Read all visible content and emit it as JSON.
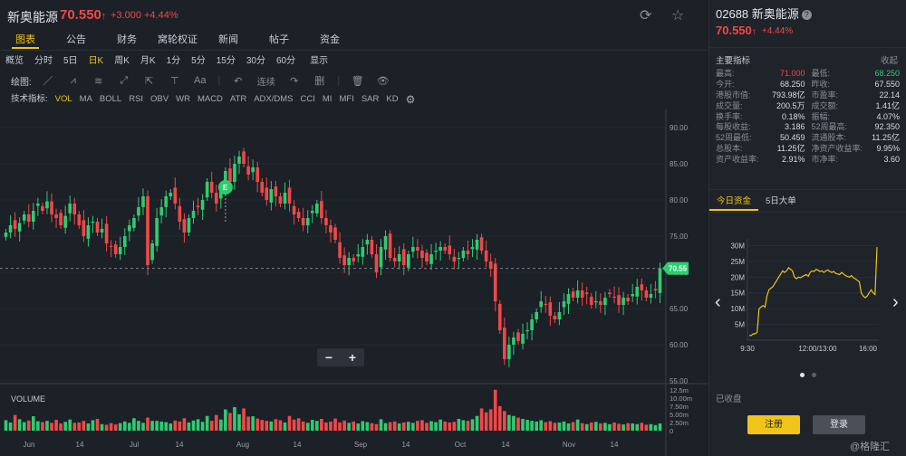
{
  "header": {
    "name": "新奥能源",
    "price": "70.550",
    "arrow": "↑",
    "change": "+3.000 +4.44%",
    "refresh_icon": "refresh-icon",
    "star_icon": "star-icon"
  },
  "tabs": [
    "图表",
    "公告",
    "财务",
    "窝轮权证",
    "新闻",
    "帖子",
    "资金"
  ],
  "active_tab": 0,
  "periods": [
    "概览",
    "分时",
    "5日",
    "日K",
    "周K",
    "月K",
    "1分",
    "5分",
    "15分",
    "30分",
    "60分",
    "显示"
  ],
  "active_period": 3,
  "draw": {
    "label": "绘图:",
    "tools": [
      "／",
      "⩘",
      "≋",
      "⤢",
      "⇱",
      "⊤",
      "Aa",
      "|",
      "↶",
      "连续",
      "↷",
      "删",
      "|",
      "🗑",
      "👁"
    ]
  },
  "indicators": {
    "label": "技术指标:",
    "items": [
      "VOL",
      "MA",
      "BOLL",
      "RSI",
      "OBV",
      "WR",
      "MACD",
      "ATR",
      "ADX/DMS",
      "CCI",
      "MI",
      "MFI",
      "SAR",
      "KD"
    ],
    "active": 0
  },
  "zoom": {
    "minus": "−",
    "plus": "+"
  },
  "chart_data": {
    "type": "candlestick",
    "price_axis": [
      "90.00",
      "85.00",
      "80.00",
      "75.00",
      "70.00",
      "65.00",
      "60.00",
      "55.00"
    ],
    "ylim": [
      55,
      92.5
    ],
    "last_price": 70.55,
    "last_price_label": "70.55",
    "x_ticks": [
      "Jun",
      "14",
      "Jul",
      "14",
      "Aug",
      "14",
      "Sep",
      "14",
      "Oct",
      "14",
      "Nov",
      "14"
    ],
    "volume_label": "VOLUME",
    "volume_axis": [
      "12.5m",
      "10.00m",
      "7.50m",
      "5.00m",
      "2.50m",
      "0"
    ],
    "volume_ylim": [
      0,
      13
    ],
    "event_marker": "E",
    "closes": [
      75.5,
      76.5,
      76.0,
      76.8,
      78.0,
      77.0,
      78.5,
      79.5,
      78.5,
      79.8,
      78.0,
      77.5,
      76.5,
      77.8,
      79.5,
      78.0,
      76.5,
      75.0,
      76.5,
      77.0,
      75.5,
      76.0,
      74.0,
      73.5,
      72.5,
      73.5,
      75.0,
      76.5,
      77.5,
      79.0,
      80.5,
      71.0,
      74.0,
      77.5,
      79.0,
      80.5,
      81.0,
      79.5,
      77.0,
      75.5,
      77.5,
      78.5,
      79.0,
      80.0,
      82.5,
      81.0,
      79.5,
      81.5,
      84.0,
      82.5,
      85.0,
      86.0,
      85.0,
      83.5,
      84.5,
      82.5,
      81.0,
      80.0,
      81.5,
      80.5,
      79.5,
      81.0,
      79.5,
      78.0,
      77.5,
      76.5,
      77.5,
      78.5,
      79.5,
      77.5,
      76.5,
      75.5,
      74.5,
      72.0,
      71.0,
      72.0,
      71.5,
      72.5,
      73.5,
      74.5,
      72.5,
      70.0,
      73.5,
      75.0,
      72.0,
      71.5,
      72.5,
      71.0,
      72.5,
      73.5,
      73.0,
      72.0,
      71.5,
      72.5,
      73.0,
      73.5,
      73.0,
      72.5,
      71.5,
      72.0,
      73.0,
      72.5,
      73.5,
      74.5,
      73.0,
      71.5,
      70.5,
      66.0,
      62.0,
      58.0,
      60.0,
      61.0,
      60.5,
      61.5,
      62.0,
      63.5,
      64.5,
      66.0,
      65.5,
      64.0,
      63.5,
      64.5,
      66.0,
      67.0,
      66.5,
      67.5,
      66.5,
      67.0,
      65.5,
      66.0,
      65.5,
      66.5,
      67.0,
      66.5,
      65.5,
      66.5,
      66.0,
      67.0,
      68.0,
      67.5,
      66.5,
      67.0,
      67.5,
      70.55
    ],
    "volumes": [
      3.2,
      2.5,
      4.8,
      3.5,
      2.6,
      3.1,
      4.4,
      2.9,
      2.6,
      3.0,
      2.4,
      3.3,
      2.2,
      2.7,
      3.4,
      2.4,
      2.5,
      3.0,
      2.2,
      3.2,
      3.6,
      2.0,
      1.8,
      2.3,
      1.9,
      2.3,
      2.8,
      2.4,
      3.8,
      3.0,
      2.4,
      4.0,
      3.0,
      3.0,
      2.8,
      2.6,
      2.2,
      3.1,
      2.8,
      3.8,
      2.5,
      3.1,
      3.5,
      2.7,
      4.5,
      3.0,
      4.8,
      3.4,
      6.5,
      5.4,
      7.2,
      5.0,
      6.8,
      4.3,
      4.4,
      3.7,
      3.3,
      3.0,
      2.8,
      3.5,
      3.2,
      2.5,
      4.5,
      3.4,
      3.8,
      2.8,
      2.4,
      3.3,
      3.0,
      3.6,
      2.5,
      2.8,
      3.7,
      2.5,
      3.1,
      2.4,
      2.8,
      2.2,
      2.9,
      2.6,
      2.3,
      2.0,
      3.5,
      2.3,
      2.6,
      2.8,
      2.2,
      2.5,
      2.7,
      2.4,
      3.0,
      3.2,
      2.4,
      2.9,
      2.6,
      3.4,
      2.8,
      2.5,
      2.7,
      3.6,
      3.2,
      3.0,
      3.5,
      4.5,
      6.8,
      5.6,
      6.5,
      12.5,
      7.5,
      6.0,
      4.8,
      4.5,
      4.0,
      3.6,
      3.3,
      3.0,
      2.8,
      3.2,
      2.6,
      2.9,
      2.4,
      2.5,
      2.8,
      2.2,
      2.6,
      3.4,
      2.3,
      2.0,
      2.5,
      2.7,
      2.2,
      2.4,
      2.0,
      2.5,
      2.1,
      1.9,
      2.3,
      2.2,
      2.0,
      2.4,
      1.8,
      2.0,
      1.7,
      2.2
    ]
  },
  "right": {
    "code": "02688",
    "name": "新奥能源",
    "help": "?",
    "price": "70.550",
    "arrow": "↑",
    "change": "+4.44%",
    "section": "主要指标",
    "collapse": "收起",
    "metrics": [
      [
        {
          "k": "最高:",
          "v": "71.000",
          "c": "red"
        },
        {
          "k": "最低:",
          "v": "68.250",
          "c": "green"
        }
      ],
      [
        {
          "k": "今开:",
          "v": "68.250",
          "c": ""
        },
        {
          "k": "昨收:",
          "v": "67.550",
          "c": ""
        }
      ],
      [
        {
          "k": "港股市值:",
          "v": "793.98亿",
          "c": ""
        },
        {
          "k": "市盈率:",
          "v": "22.14",
          "c": ""
        }
      ],
      [
        {
          "k": "成交量:",
          "v": "200.5万",
          "c": ""
        },
        {
          "k": "成交额:",
          "v": "1.41亿",
          "c": ""
        }
      ],
      [
        {
          "k": "换手率:",
          "v": "0.18%",
          "c": ""
        },
        {
          "k": "振幅:",
          "v": "4.07%",
          "c": ""
        }
      ],
      [
        {
          "k": "每股收益:",
          "v": "3.186",
          "c": ""
        },
        {
          "k": "52周最高:",
          "v": "92.350",
          "c": ""
        }
      ],
      [
        {
          "k": "52周最低:",
          "v": "50.459",
          "c": ""
        },
        {
          "k": "流通股本:",
          "v": "11.25亿",
          "c": ""
        }
      ],
      [
        {
          "k": "总股本:",
          "v": "11.25亿",
          "c": ""
        },
        {
          "k": "净资产收益率:",
          "v": "9.95%",
          "c": ""
        }
      ],
      [
        {
          "k": "资产收益率:",
          "v": "2.91%",
          "c": ""
        },
        {
          "k": "市净率:",
          "v": "3.60",
          "c": ""
        }
      ]
    ],
    "tabs": [
      "今日资金",
      "5日大单"
    ],
    "closed": "已收盘",
    "register": "注册",
    "login": "登录"
  },
  "fund_chart": {
    "type": "line",
    "y_axis": [
      "30M",
      "25M",
      "20M",
      "15M",
      "10M",
      "5M"
    ],
    "ylim": [
      0,
      31
    ],
    "x_axis": [
      "9:30",
      "12:00/13:00",
      "16:00"
    ],
    "values": [
      1.5,
      1.5,
      2,
      2,
      2.5,
      10,
      10.5,
      11,
      10.5,
      14,
      16,
      16.5,
      17,
      18,
      19,
      20,
      21,
      22,
      21.5,
      22,
      23,
      22.5,
      22,
      20,
      19.5,
      20,
      19.8,
      20.2,
      20.5,
      20.8,
      20.3,
      21.5,
      22,
      21.8,
      22.5,
      22.2,
      21.8,
      22,
      21.5,
      22,
      22.3,
      21.8,
      21.5,
      21.8,
      21.2,
      21,
      20.8,
      21.5,
      21,
      20.5,
      20.2,
      20,
      20.5,
      19.8,
      19.5,
      19,
      18.5,
      15,
      14,
      13.5,
      14,
      15,
      16,
      15,
      14.5,
      29.5
    ],
    "line_color": "#f0c419",
    "prev_arrow": "‹",
    "next_arrow": "›"
  },
  "watermark": "@格隆汇"
}
